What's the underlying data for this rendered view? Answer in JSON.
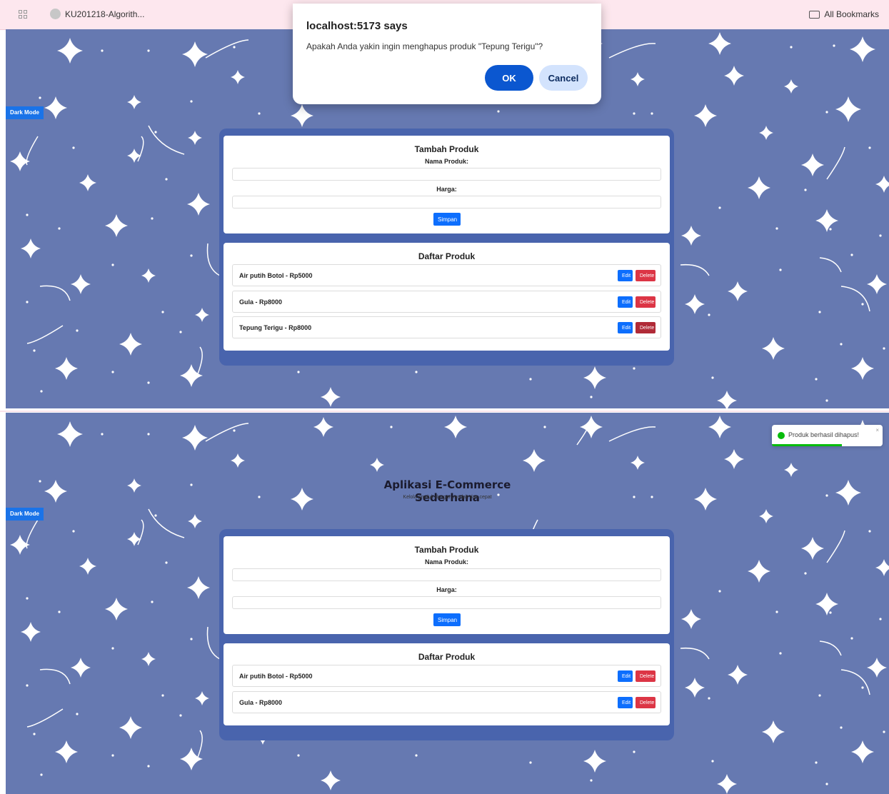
{
  "browser": {
    "bookmark_label": "KU201218-Algorith...",
    "all_bookmarks": "All Bookmarks"
  },
  "dialog": {
    "title": "localhost:5173 says",
    "message": "Apakah Anda yakin ingin menghapus produk \"Tepung Terigu\"?",
    "ok_label": "OK",
    "cancel_label": "Cancel"
  },
  "app": {
    "dark_mode_label": "Dark Mode",
    "title": "Aplikasi E-Commerce Sederhana",
    "subtitle": "Kelola produk dengan mudah dan cepat",
    "form": {
      "title": "Tambah Produk",
      "name_label": "Nama Produk:",
      "price_label": "Harga:",
      "save_label": "Simpan"
    },
    "list_title": "Daftar Produk",
    "edit_label": "Edit",
    "delete_label": "Delete",
    "products_before": [
      "Air putih Botol - Rp5000",
      "Gula - Rp8000",
      "Tepung Terigu - Rp8000"
    ],
    "products_after": [
      "Air putih Botol - Rp5000",
      "Gula - Rp8000"
    ]
  },
  "toast": {
    "message": "Produk berhasil dihapus!",
    "close": "×",
    "progress": 0.63
  },
  "colors": {
    "background": "#6679b1",
    "container": "#4964ad",
    "primary": "#0d6efd",
    "danger": "#dc3545",
    "toast_success": "#07bc0c"
  }
}
